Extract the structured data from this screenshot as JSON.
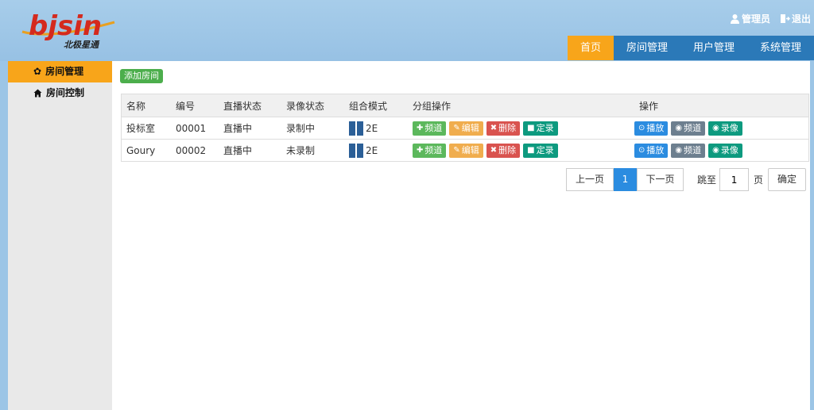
{
  "header": {
    "logo_text": "bjsin",
    "logo_subtext": "北极星通",
    "admin_label": "管理员",
    "logout_label": "退出",
    "nav": [
      {
        "label": "首页",
        "active": true
      },
      {
        "label": "房间管理",
        "active": false
      },
      {
        "label": "用户管理",
        "active": false
      },
      {
        "label": "系统管理",
        "active": false
      }
    ]
  },
  "sidebar": {
    "items": [
      {
        "label": "房间管理",
        "icon": "gear-icon",
        "active": true
      },
      {
        "label": "房间控制",
        "icon": "home-icon",
        "active": false
      }
    ]
  },
  "main": {
    "add_button": "添加房间",
    "table": {
      "headers": [
        "名称",
        "编号",
        "直播状态",
        "录像状态",
        "组合模式",
        "分组操作",
        "操作"
      ],
      "rows": [
        {
          "name": "投标室",
          "code": "00001",
          "live": "直播中",
          "rec": "录制中",
          "mode": "2E"
        },
        {
          "name": "Goury",
          "code": "00002",
          "live": "直播中",
          "rec": "未录制",
          "mode": "2E"
        }
      ],
      "group_buttons": [
        "频道",
        "编辑",
        "删除",
        "定录"
      ],
      "op_buttons": [
        "播放",
        "频道",
        "录像"
      ]
    },
    "pager": {
      "prev": "上一页",
      "current": "1",
      "next": "下一页",
      "jump_label": "跳至",
      "jump_value": "1",
      "page_unit": "页",
      "ok": "确定"
    }
  },
  "colors": {
    "header_bg": "#9cc5e6",
    "nav_bg": "#2b79b8",
    "accent": "#f8a51a",
    "logo_red": "#d42a1e"
  }
}
